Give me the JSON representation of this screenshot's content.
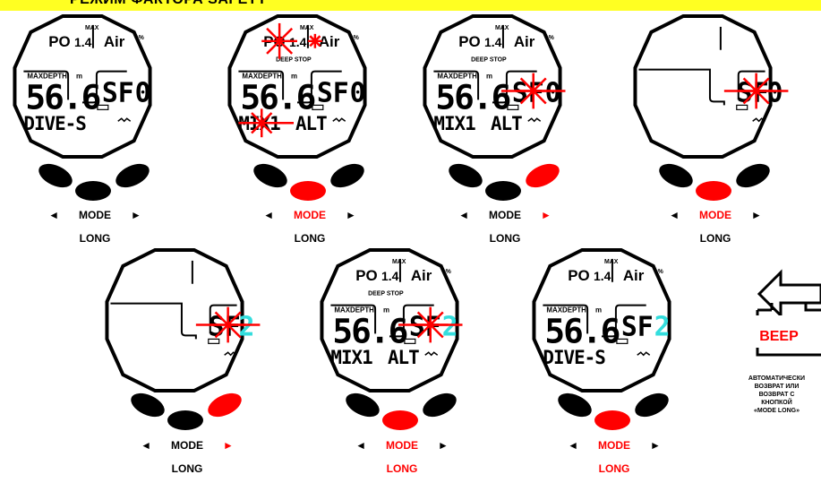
{
  "banner": {
    "title": "РЕЖИМ ФАКТОРА SAFETY",
    "color": "#ffff22"
  },
  "lcd": {
    "max": "MAX",
    "po2": "PO",
    "po2_value": "1.4",
    "gas": "Air",
    "percent": "%",
    "deep_stop": "DEEP STOP",
    "maxdepth": "MAXDEPTH",
    "unit_m": "m",
    "depth_value": "56.6",
    "sf0": "SF0",
    "sf": "SF",
    "sf2": "2",
    "dive_s": "DIVE-S",
    "mix": "MIX1",
    "alt": "ALT"
  },
  "labels": {
    "mode": "MODE",
    "long": "LONG",
    "left_arrow": "◄",
    "right_arrow": "►"
  },
  "beep": {
    "label": "BEEP",
    "note": [
      "АВТОМАТИЧЕСКИ",
      "ВОЗВРАТ ИЛИ",
      "ВОЗВРАТ С",
      "КНОПКОЙ",
      "«MODE LONG»"
    ]
  },
  "colors": {
    "flash": "#ff0000",
    "highlight_digit": "#33dddd",
    "banner": "#ffff22",
    "button": "#000000"
  },
  "watches": [
    {
      "id": 1,
      "type": "full",
      "bottom": "dive",
      "flash": "none",
      "sf_digit": "0",
      "active_button": "none",
      "mode_red": false,
      "right_red": false,
      "long_red": false
    },
    {
      "id": 2,
      "type": "full",
      "bottom": "mix",
      "flash": "top",
      "sf_digit": "0",
      "active_button": "mid",
      "mode_red": true,
      "right_red": false,
      "long_red": false
    },
    {
      "id": 3,
      "type": "full",
      "bottom": "mix",
      "flash": "sf",
      "sf_digit": "0",
      "active_button": "right",
      "mode_red": false,
      "right_red": true,
      "long_red": false
    },
    {
      "id": 4,
      "type": "partial",
      "bottom": "",
      "flash": "sf",
      "sf_digit": "0",
      "active_button": "mid",
      "mode_red": true,
      "right_red": false,
      "long_red": false
    },
    {
      "id": 5,
      "type": "partial",
      "bottom": "",
      "flash": "sf",
      "sf_digit": "2",
      "active_button": "right",
      "mode_red": false,
      "right_red": true,
      "long_red": false
    },
    {
      "id": 6,
      "type": "full",
      "bottom": "mix",
      "flash": "sf",
      "sf_digit": "2",
      "active_button": "mid",
      "mode_red": true,
      "right_red": false,
      "long_red": true
    },
    {
      "id": 7,
      "type": "full",
      "bottom": "dive",
      "flash": "none",
      "sf_digit": "2",
      "active_button": "mid",
      "mode_red": true,
      "right_red": false,
      "long_red": true
    }
  ]
}
